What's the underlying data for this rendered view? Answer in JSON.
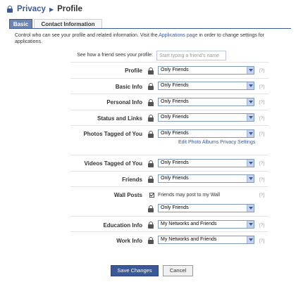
{
  "header": {
    "breadcrumb_parent": "Privacy",
    "breadcrumb_sep": "▶",
    "breadcrumb_current": "Profile"
  },
  "tabs": [
    {
      "label": "Basic",
      "selected": true
    },
    {
      "label": "Contact Information",
      "selected": false
    }
  ],
  "intro": {
    "text_before": "Control who can see your profile and related information. Visit the ",
    "link": "Applications page",
    "text_after": " in order to change settings for applications."
  },
  "preview": {
    "label": "See how a friend sees your profile:",
    "placeholder": "Start typing a friend's name"
  },
  "rows": {
    "profile": {
      "label": "Profile",
      "value": "Only Friends"
    },
    "basic": {
      "label": "Basic Info",
      "value": "Only Friends"
    },
    "personal": {
      "label": "Personal Info",
      "value": "Only Friends"
    },
    "status": {
      "label": "Status and Links",
      "value": "Only Friends"
    },
    "photos": {
      "label": "Photos Tagged of You",
      "value": "Only Friends"
    },
    "videos": {
      "label": "Videos Tagged of You",
      "value": "Only Friends"
    },
    "friends": {
      "label": "Friends",
      "value": "Only Friends"
    },
    "wall": {
      "label": "Wall Posts",
      "value": "Only Friends",
      "checkbox_label": "Friends may post to my Wall",
      "checked": true
    },
    "education": {
      "label": "Education Info",
      "value": "My Networks and Friends"
    },
    "work": {
      "label": "Work Info",
      "value": "My Networks and Friends"
    }
  },
  "help_label": "[?]",
  "edit_photo_link": "Edit Photo Albums Privacy Settings",
  "buttons": {
    "save": "Save Changes",
    "cancel": "Cancel"
  },
  "colors": {
    "brand": "#3b5998",
    "tab_selected": "#6d84b4",
    "select_border": "#7f9db9"
  },
  "icons": {
    "privacy": "lock-icon",
    "dropdown": "chevron-down-icon"
  }
}
